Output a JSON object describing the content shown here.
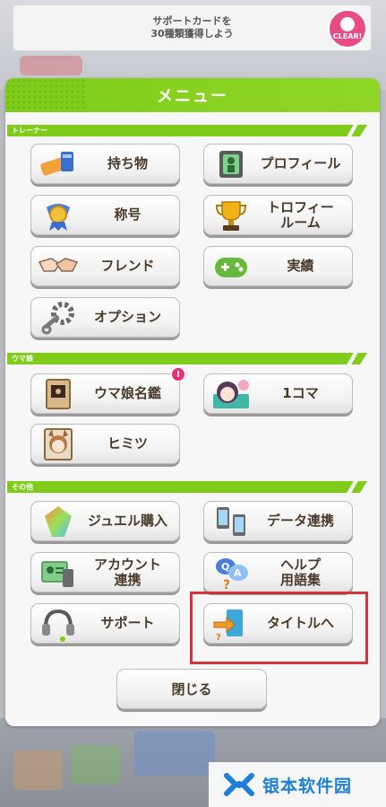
{
  "banner": {
    "text": "サポートカードを\n30種類獲得しよう",
    "badge": "CLEAR!"
  },
  "menu": {
    "title": "メニュー",
    "sections": {
      "trainer": "トレーナー",
      "umamusume": "ウマ娘",
      "other": "その他"
    },
    "buttons": {
      "items": "持ち物",
      "profile": "プロフィール",
      "titles": "称号",
      "trophy_room": "トロフィー\nルーム",
      "friends": "フレンド",
      "achievements": "実績",
      "options": "オプション",
      "encyclopedia": "ウマ娘名鑑",
      "one_koma": "1コマ",
      "secrets": "ヒミツ",
      "jewel_purchase": "ジュエル購入",
      "data_link": "データ連携",
      "account_link": "アカウント\n連携",
      "help": "ヘルプ\n用語集",
      "support": "サポート",
      "to_title": "タイトルへ"
    },
    "notification_badge": "!",
    "close": "閉じる"
  },
  "watermark": {
    "text": "银本软件园"
  },
  "colors": {
    "accent_green": "#7fcc1b",
    "highlight_red": "#d4343a",
    "label_brown": "#4a3a2a"
  }
}
